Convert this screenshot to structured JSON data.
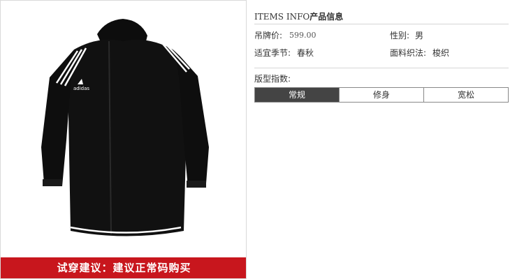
{
  "product_image": {
    "icon": "black-hooded-zip-jacket-image",
    "brand_logo_text": "adidas",
    "fit_banner": "试穿建议：建议正常码购买"
  },
  "info": {
    "title_en": "ITEMS INFO",
    "title_cn": "产品信息",
    "price_label": "吊牌价:",
    "price_value": "599.00",
    "gender_label": "性别:",
    "gender_value": "男",
    "season_label": "适宜季节:",
    "season_value": "春秋",
    "fabric_label": "面料织法:",
    "fabric_value": "梭织",
    "fit_label": "版型指数:",
    "fit_options": [
      {
        "label": "常规",
        "active": true
      },
      {
        "label": "修身",
        "active": false
      },
      {
        "label": "宽松",
        "active": false
      }
    ]
  },
  "colors": {
    "banner_red": "#c8161d",
    "active_fit_bg": "#444444"
  }
}
